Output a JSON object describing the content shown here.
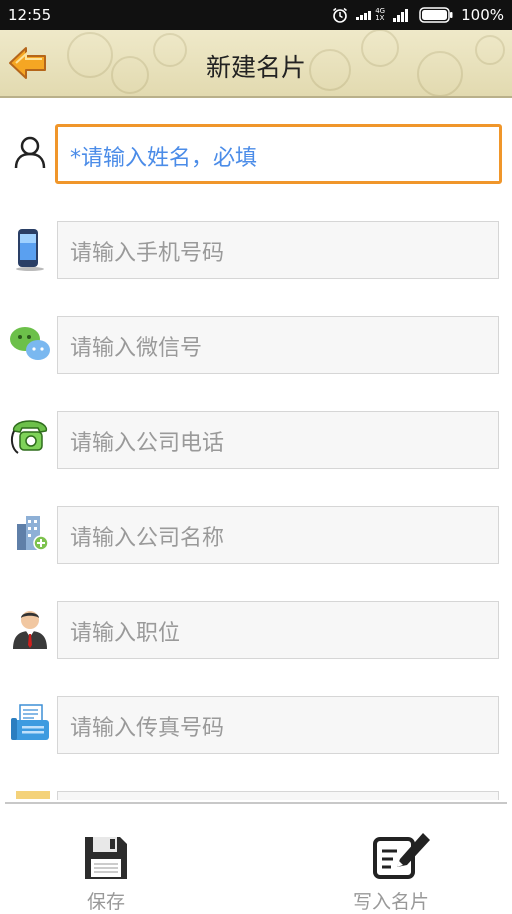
{
  "status_bar": {
    "time": "12:55",
    "network": "4G",
    "sim": "1X",
    "battery": "100%"
  },
  "header": {
    "title": "新建名片",
    "back_icon": "back-arrow-icon"
  },
  "form": {
    "fields": [
      {
        "placeholder": "*请输入姓名，必填",
        "icon": "person-outline-icon",
        "active": true
      },
      {
        "placeholder": "请输入手机号码",
        "icon": "mobile-phone-icon"
      },
      {
        "placeholder": "请输入微信号",
        "icon": "wechat-icon"
      },
      {
        "placeholder": "请输入公司电话",
        "icon": "telephone-icon"
      },
      {
        "placeholder": "请输入公司名称",
        "icon": "company-building-icon"
      },
      {
        "placeholder": "请输入职位",
        "icon": "business-person-icon"
      },
      {
        "placeholder": "请输入传真号码",
        "icon": "fax-icon"
      }
    ]
  },
  "bottom_bar": {
    "save_label": "保存",
    "write_card_label": "写入名片"
  },
  "colors": {
    "header_bg": "#e6dfb8",
    "active_border": "#f0962a",
    "placeholder_active": "#4b8ce8",
    "placeholder": "#9a9a9a"
  }
}
